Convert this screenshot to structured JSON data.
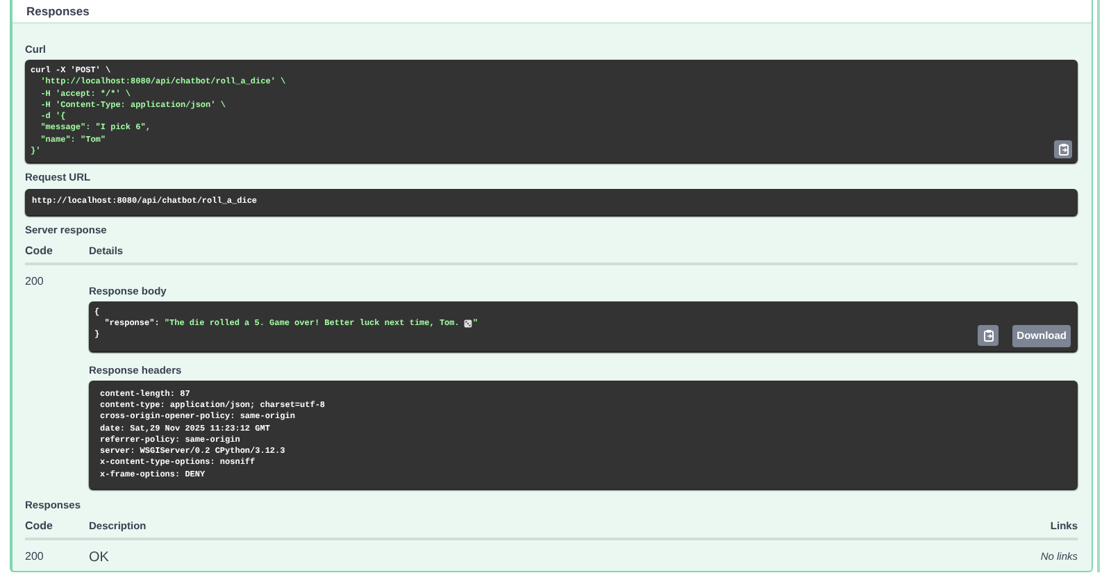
{
  "header": {
    "title": "Responses"
  },
  "curl": {
    "label": "Curl",
    "lines": [
      "curl -X 'POST' \\",
      "  'http://localhost:8080/api/chatbot/roll_a_dice' \\",
      "  -H 'accept: */*' \\",
      "  -H 'Content-Type: application/json' \\",
      "  -d '{",
      "  \"message\": \"I pick 6\",",
      "  \"name\": \"Tom\"",
      "}'"
    ]
  },
  "request_url": {
    "label": "Request URL",
    "value": "http://localhost:8080/api/chatbot/roll_a_dice"
  },
  "server_response": {
    "label": "Server response",
    "columns": [
      "Code",
      "Details"
    ],
    "code": "200",
    "body": {
      "label": "Response body",
      "open": "{",
      "key": "  \"response\": ",
      "value_before_icon": "\"The die rolled a 5. Game over! Better luck next time, Tom. ",
      "value_after_icon": "\"",
      "close": "}",
      "download": "Download"
    },
    "headers": {
      "label": "Response headers",
      "lines": [
        "content-length: 87",
        "content-type: application/json; charset=utf-8",
        "cross-origin-opener-policy: same-origin",
        "date: Sat,29 Nov 2025 11:23:12 GMT",
        "referrer-policy: same-origin",
        "server: WSGIServer/0.2 CPython/3.12.3",
        "x-content-type-options: nosniff",
        "x-frame-options: DENY"
      ]
    }
  },
  "responses": {
    "label": "Responses",
    "columns": [
      "Code",
      "Description",
      "Links"
    ],
    "rows": [
      {
        "code": "200",
        "description": "OK",
        "links": "No links"
      }
    ]
  }
}
